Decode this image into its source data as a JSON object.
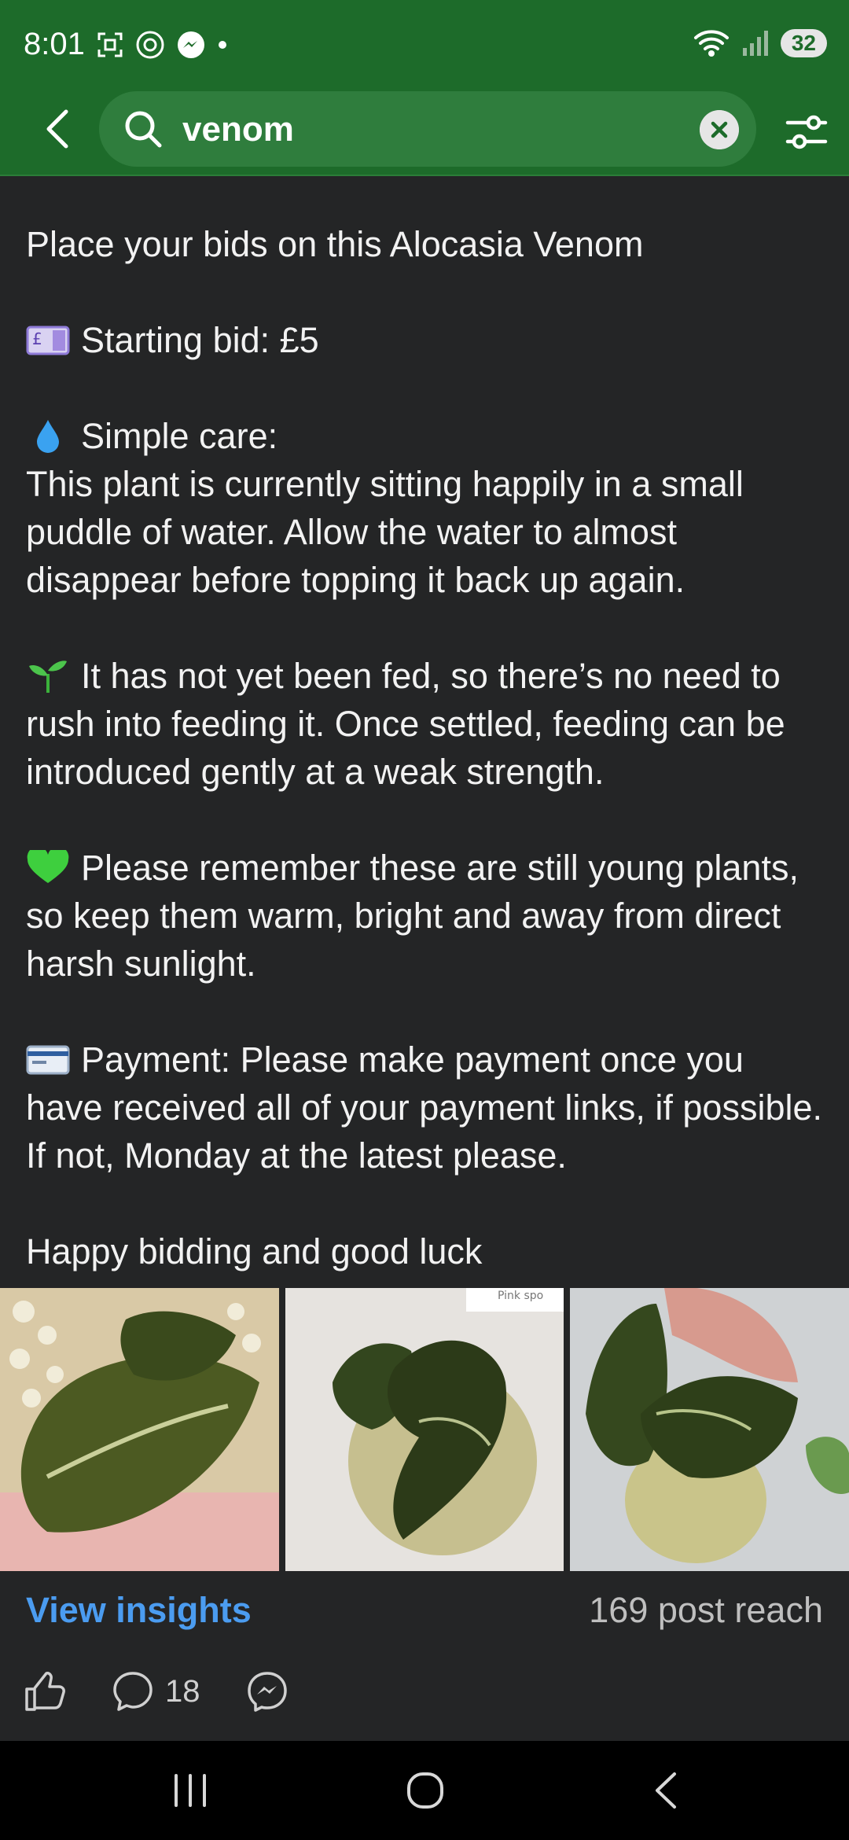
{
  "status_bar": {
    "time": "8:01",
    "battery": "32"
  },
  "search": {
    "query": "venom"
  },
  "post": {
    "line1": "Place your bids on this Alocasia Venom",
    "starting_bid": "Starting bid: £5",
    "care_heading": "Simple care:",
    "care_text": "This plant is currently sitting happily in a small puddle of water. Allow the water to almost disappear before topping it back up again.",
    "feeding_text": "It has not yet been fed, so there’s no need to rush into feeding it. Once settled, feeding can be introduced gently at a weak strength.",
    "young_plants_text": "Please remember these are still young plants, so keep them warm, bright and away from direct harsh sunlight.",
    "payment_text": "Payment: Please make payment once you have received all of your payment links, if possible. If not, Monday at the latest please.",
    "closing": "Happy bidding and good luck",
    "photo_caption_partial": "Pink spo"
  },
  "insights": {
    "link_label": "View insights",
    "reach": "169 post reach"
  },
  "actions": {
    "comment_count": "18"
  },
  "colors": {
    "header_green": "#1d6b2a",
    "background": "#242526",
    "link_blue": "#4b9cf0"
  }
}
